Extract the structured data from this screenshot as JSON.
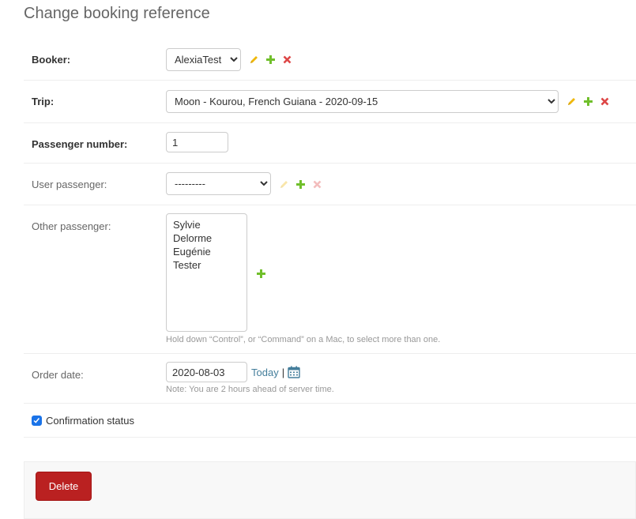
{
  "page": {
    "title": "Change booking reference"
  },
  "booker": {
    "label": "Booker:",
    "value": "AlexiaTest"
  },
  "trip": {
    "label": "Trip:",
    "value": "Moon - Kourou, French Guiana - 2020-09-15"
  },
  "passenger_number": {
    "label": "Passenger number:",
    "value": "1"
  },
  "user_passenger": {
    "label": "User passenger:",
    "value": "---------"
  },
  "other_passenger": {
    "label": "Other passenger:",
    "options": [
      "Sylvie Delorme",
      "Eugénie Tester"
    ],
    "help": "Hold down “Control”, or “Command” on a Mac, to select more than one."
  },
  "order_date": {
    "label": "Order date:",
    "value": "2020-08-03",
    "today_label": "Today",
    "separator": "|",
    "note": "Note: You are 2 hours ahead of server time."
  },
  "confirmation": {
    "label": "Confirmation status",
    "checked": true
  },
  "actions": {
    "delete_label": "Delete"
  },
  "colors": {
    "change": "#efb80b",
    "add": "#70bf2b",
    "delete": "#dd4646",
    "link": "#447e9b",
    "delete_button": "#ba2121"
  }
}
